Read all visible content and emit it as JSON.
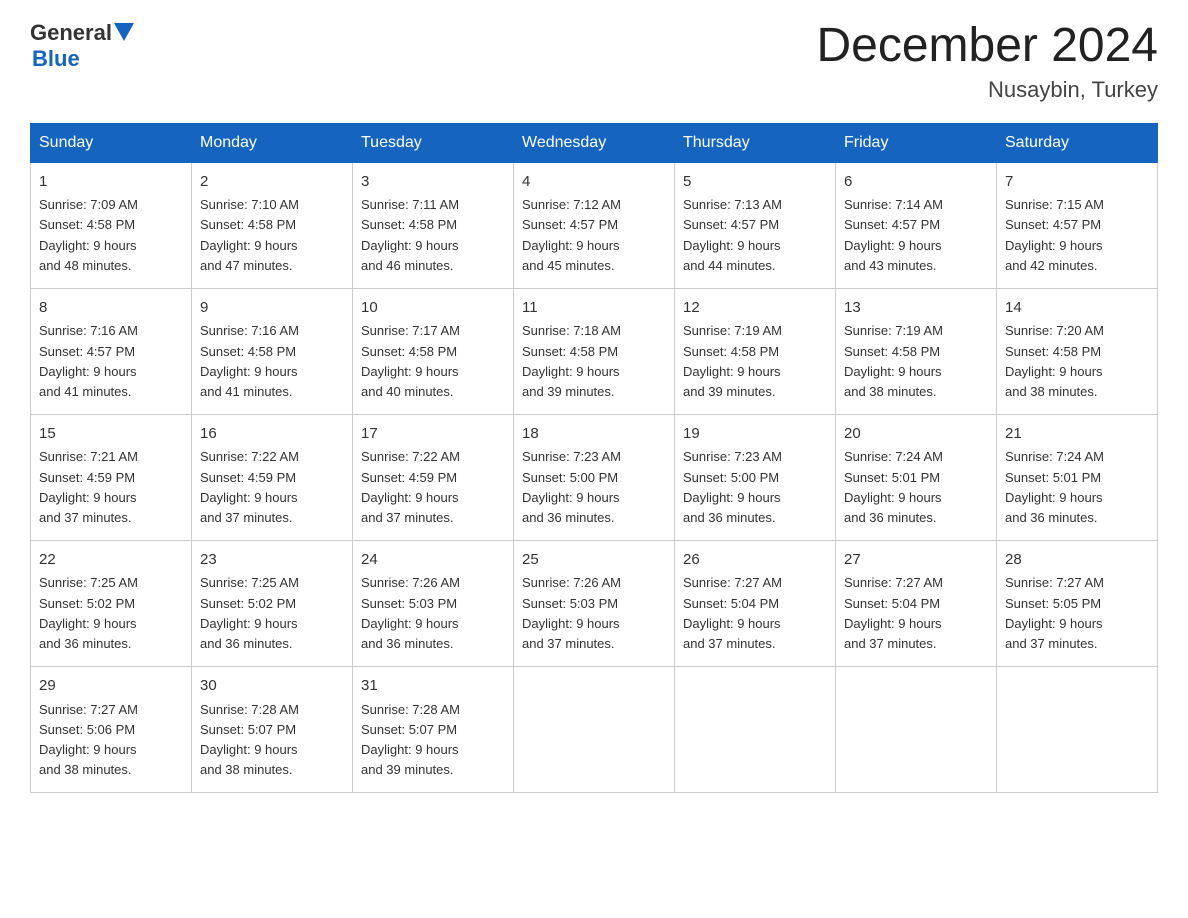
{
  "header": {
    "logo_general": "General",
    "logo_blue": "Blue",
    "title": "December 2024",
    "location": "Nusaybin, Turkey"
  },
  "weekdays": [
    "Sunday",
    "Monday",
    "Tuesday",
    "Wednesday",
    "Thursday",
    "Friday",
    "Saturday"
  ],
  "weeks": [
    [
      {
        "day": "1",
        "sunrise": "7:09 AM",
        "sunset": "4:58 PM",
        "daylight": "9 hours and 48 minutes."
      },
      {
        "day": "2",
        "sunrise": "7:10 AM",
        "sunset": "4:58 PM",
        "daylight": "9 hours and 47 minutes."
      },
      {
        "day": "3",
        "sunrise": "7:11 AM",
        "sunset": "4:58 PM",
        "daylight": "9 hours and 46 minutes."
      },
      {
        "day": "4",
        "sunrise": "7:12 AM",
        "sunset": "4:57 PM",
        "daylight": "9 hours and 45 minutes."
      },
      {
        "day": "5",
        "sunrise": "7:13 AM",
        "sunset": "4:57 PM",
        "daylight": "9 hours and 44 minutes."
      },
      {
        "day": "6",
        "sunrise": "7:14 AM",
        "sunset": "4:57 PM",
        "daylight": "9 hours and 43 minutes."
      },
      {
        "day": "7",
        "sunrise": "7:15 AM",
        "sunset": "4:57 PM",
        "daylight": "9 hours and 42 minutes."
      }
    ],
    [
      {
        "day": "8",
        "sunrise": "7:16 AM",
        "sunset": "4:57 PM",
        "daylight": "9 hours and 41 minutes."
      },
      {
        "day": "9",
        "sunrise": "7:16 AM",
        "sunset": "4:58 PM",
        "daylight": "9 hours and 41 minutes."
      },
      {
        "day": "10",
        "sunrise": "7:17 AM",
        "sunset": "4:58 PM",
        "daylight": "9 hours and 40 minutes."
      },
      {
        "day": "11",
        "sunrise": "7:18 AM",
        "sunset": "4:58 PM",
        "daylight": "9 hours and 39 minutes."
      },
      {
        "day": "12",
        "sunrise": "7:19 AM",
        "sunset": "4:58 PM",
        "daylight": "9 hours and 39 minutes."
      },
      {
        "day": "13",
        "sunrise": "7:19 AM",
        "sunset": "4:58 PM",
        "daylight": "9 hours and 38 minutes."
      },
      {
        "day": "14",
        "sunrise": "7:20 AM",
        "sunset": "4:58 PM",
        "daylight": "9 hours and 38 minutes."
      }
    ],
    [
      {
        "day": "15",
        "sunrise": "7:21 AM",
        "sunset": "4:59 PM",
        "daylight": "9 hours and 37 minutes."
      },
      {
        "day": "16",
        "sunrise": "7:22 AM",
        "sunset": "4:59 PM",
        "daylight": "9 hours and 37 minutes."
      },
      {
        "day": "17",
        "sunrise": "7:22 AM",
        "sunset": "4:59 PM",
        "daylight": "9 hours and 37 minutes."
      },
      {
        "day": "18",
        "sunrise": "7:23 AM",
        "sunset": "5:00 PM",
        "daylight": "9 hours and 36 minutes."
      },
      {
        "day": "19",
        "sunrise": "7:23 AM",
        "sunset": "5:00 PM",
        "daylight": "9 hours and 36 minutes."
      },
      {
        "day": "20",
        "sunrise": "7:24 AM",
        "sunset": "5:01 PM",
        "daylight": "9 hours and 36 minutes."
      },
      {
        "day": "21",
        "sunrise": "7:24 AM",
        "sunset": "5:01 PM",
        "daylight": "9 hours and 36 minutes."
      }
    ],
    [
      {
        "day": "22",
        "sunrise": "7:25 AM",
        "sunset": "5:02 PM",
        "daylight": "9 hours and 36 minutes."
      },
      {
        "day": "23",
        "sunrise": "7:25 AM",
        "sunset": "5:02 PM",
        "daylight": "9 hours and 36 minutes."
      },
      {
        "day": "24",
        "sunrise": "7:26 AM",
        "sunset": "5:03 PM",
        "daylight": "9 hours and 36 minutes."
      },
      {
        "day": "25",
        "sunrise": "7:26 AM",
        "sunset": "5:03 PM",
        "daylight": "9 hours and 37 minutes."
      },
      {
        "day": "26",
        "sunrise": "7:27 AM",
        "sunset": "5:04 PM",
        "daylight": "9 hours and 37 minutes."
      },
      {
        "day": "27",
        "sunrise": "7:27 AM",
        "sunset": "5:04 PM",
        "daylight": "9 hours and 37 minutes."
      },
      {
        "day": "28",
        "sunrise": "7:27 AM",
        "sunset": "5:05 PM",
        "daylight": "9 hours and 37 minutes."
      }
    ],
    [
      {
        "day": "29",
        "sunrise": "7:27 AM",
        "sunset": "5:06 PM",
        "daylight": "9 hours and 38 minutes."
      },
      {
        "day": "30",
        "sunrise": "7:28 AM",
        "sunset": "5:07 PM",
        "daylight": "9 hours and 38 minutes."
      },
      {
        "day": "31",
        "sunrise": "7:28 AM",
        "sunset": "5:07 PM",
        "daylight": "9 hours and 39 minutes."
      },
      null,
      null,
      null,
      null
    ]
  ],
  "labels": {
    "sunrise": "Sunrise:",
    "sunset": "Sunset:",
    "daylight": "Daylight:"
  }
}
